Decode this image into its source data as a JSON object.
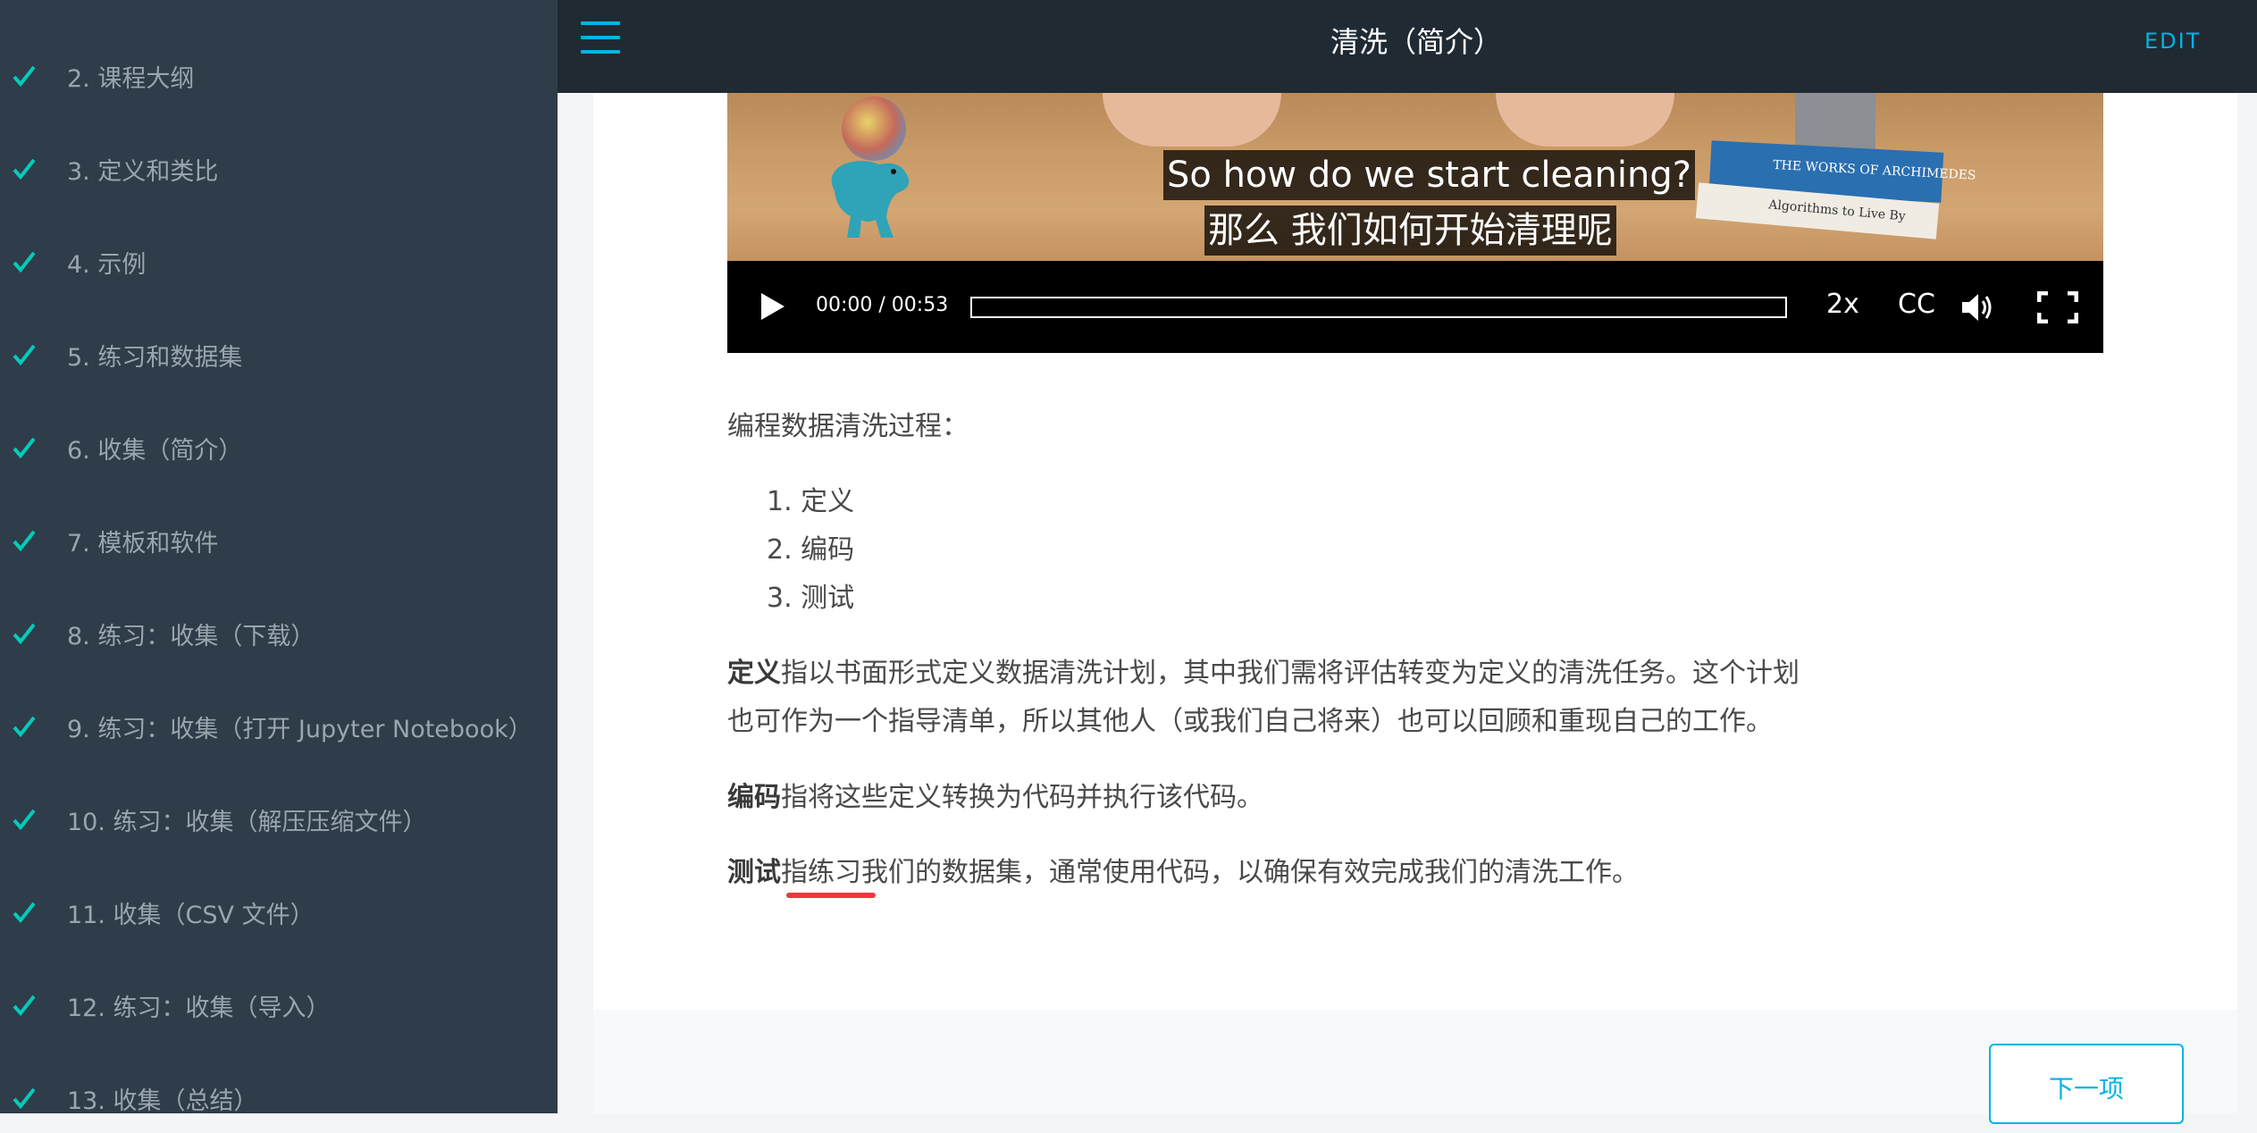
{
  "sidebar": {
    "items": [
      {
        "label": "2. 课程大纲",
        "completed": true
      },
      {
        "label": "3. 定义和类比",
        "completed": true
      },
      {
        "label": "4. 示例",
        "completed": true
      },
      {
        "label": "5. 练习和数据集",
        "completed": true
      },
      {
        "label": "6. 收集（简介）",
        "completed": true
      },
      {
        "label": "7. 模板和软件",
        "completed": true
      },
      {
        "label": "8. 练习：收集（下载）",
        "completed": true
      },
      {
        "label": "9. 练习：收集（打开 Jupyter Notebook）",
        "completed": true
      },
      {
        "label": "10. 练习：收集（解压压缩文件）",
        "completed": true
      },
      {
        "label": "11. 收集（CSV 文件）",
        "completed": true
      },
      {
        "label": "12. 练习：收集（导入）",
        "completed": true
      },
      {
        "label": "13. 收集（总结）",
        "completed": true
      }
    ]
  },
  "header": {
    "menu_icon": "hamburger-menu-icon",
    "title": "清洗（简介）",
    "edit_label": "EDIT"
  },
  "video": {
    "subtitle_en": "So how do we start cleaning?",
    "subtitle_zh": "那么 我们如何开始清理呢",
    "book_title_top": "THE WORKS OF ARCHIMEDES",
    "book_title_bottom": "Algorithms to Live By",
    "time": "00:00 / 00:53",
    "progress": 0,
    "speed": "2x",
    "cc": "CC"
  },
  "content": {
    "intro": "编程数据清洗过程：",
    "steps": [
      "定义",
      "编码",
      "测试"
    ],
    "p1_bold": "定义",
    "p1_line1": "指以书面形式定义数据清洗计划，其中我们需将评估转变为定义的清洗任务。这个计划",
    "p1_line2": "也可作为一个指导清单，所以其他人（或我们自己将来）也可以回顾和重现自己的工作。",
    "p2_bold": "编码",
    "p2_text": "指将这些定义转换为代码并执行该代码。",
    "p3_bold": "测试",
    "p3_text": "指练习我们的数据集，通常使用代码，以确保有效完成我们的清洗工作。"
  },
  "footer": {
    "next_label": "下一项"
  },
  "colors": {
    "sidebar_bg": "#2e3d49",
    "header_bg": "#1f2a33",
    "accent": "#02b3e4",
    "check": "#02ccba",
    "highlight": "#f0373f"
  }
}
